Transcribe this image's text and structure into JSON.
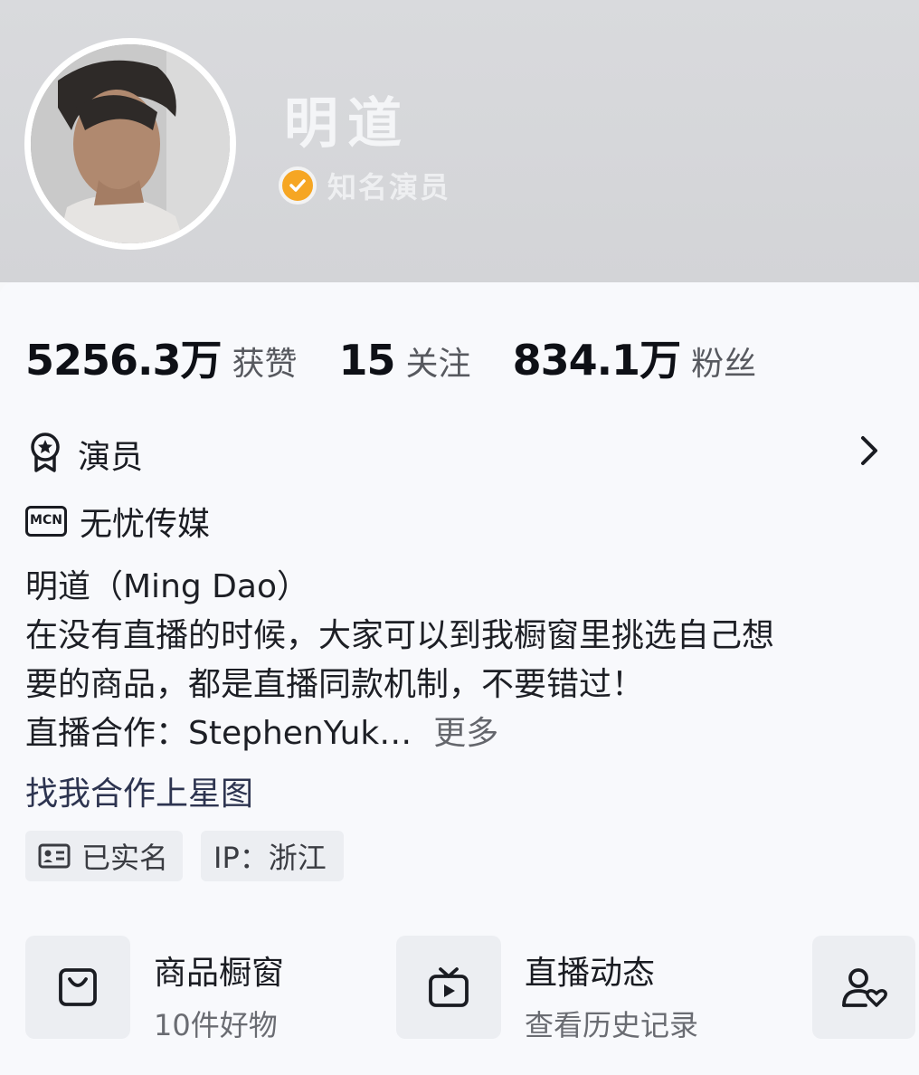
{
  "profile": {
    "name": "明道",
    "verify_label": "知名演员"
  },
  "stats": [
    {
      "value": "5256.3万",
      "label": "获赞"
    },
    {
      "value": "15",
      "label": "关注"
    },
    {
      "value": "834.1万",
      "label": "粉丝"
    }
  ],
  "info": {
    "occupation": "演员",
    "mcn_badge": "MCN",
    "mcn_name": "无忧传媒"
  },
  "bio": {
    "line1": "明道（Ming Dao）",
    "line2": "在没有直播的时候，大家可以到我橱窗里挑选自己想",
    "line3": "要的商品，都是直播同款机制，不要错过！",
    "line4": "直播合作：StephenYuk…",
    "more": "更多"
  },
  "link_text": "找我合作上星图",
  "chips": {
    "realname": "已实名",
    "ip": "IP：浙江"
  },
  "shortcuts": {
    "shop_title": "商品橱窗",
    "shop_sub": "10件好物",
    "live_title": "直播动态",
    "live_sub": "查看历史记录"
  },
  "colors": {
    "verify_badge": "#f6a623",
    "link": "#2d3450"
  }
}
